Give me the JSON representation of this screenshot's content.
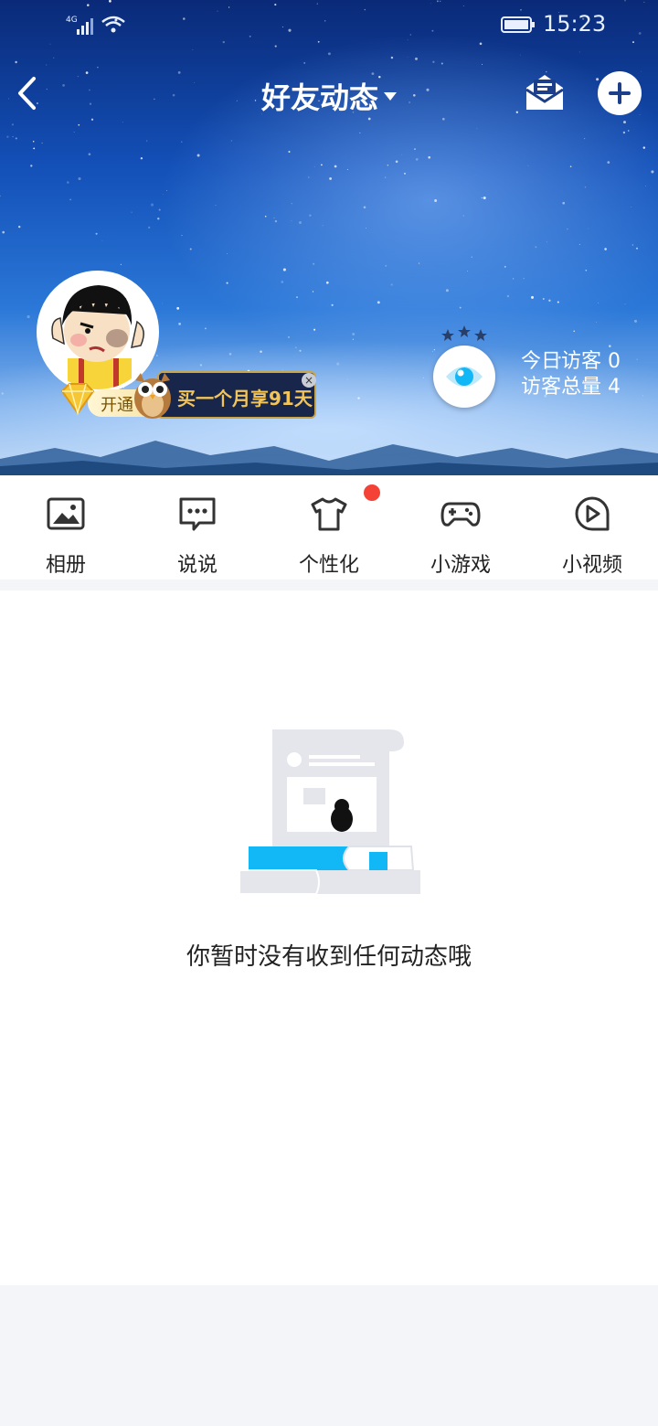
{
  "status_bar": {
    "network": "4G",
    "time": "15:23"
  },
  "header": {
    "title": "好友动态"
  },
  "profile": {
    "vip": {
      "open_label": "开通",
      "ad_text": "买一个月享91天"
    },
    "visitors": {
      "today": "今日访客 0",
      "total": "访客总量 4"
    }
  },
  "menu": {
    "items": [
      {
        "label": "相册",
        "icon": "photo-album-icon"
      },
      {
        "label": "说说",
        "icon": "chat-bubble-icon"
      },
      {
        "label": "个性化",
        "icon": "tshirt-icon"
      },
      {
        "label": "小游戏",
        "icon": "gamepad-icon"
      },
      {
        "label": "小视频",
        "icon": "play-video-icon"
      }
    ]
  },
  "empty_state": {
    "message": "你暂时没有收到任何动态哦"
  },
  "colors": {
    "accent": "#12b7f5",
    "badge": "#f44336",
    "nav_icon": "#1d3f8a"
  }
}
